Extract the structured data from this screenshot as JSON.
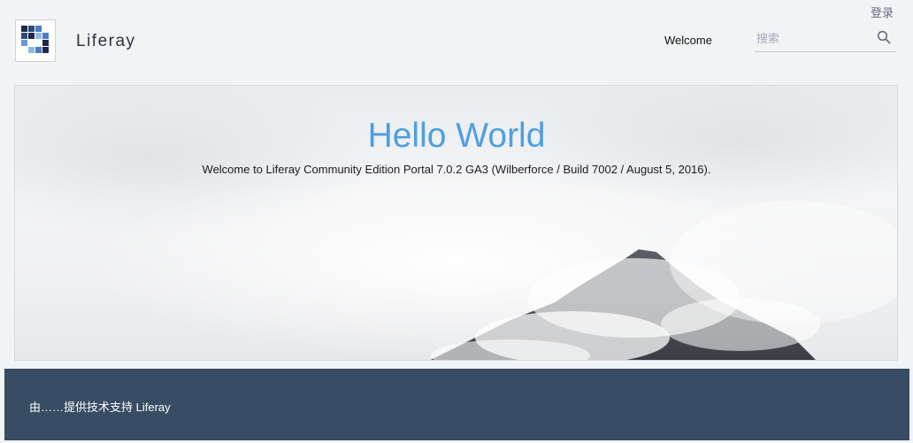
{
  "header": {
    "login_label": "登录",
    "site_name": "Liferay",
    "nav": {
      "welcome_label": "Welcome"
    },
    "search": {
      "placeholder": "搜索",
      "value": ""
    }
  },
  "hero": {
    "title": "Hello World",
    "subtitle": "Welcome to Liferay Community Edition Portal 7.0.2 GA3 (Wilberforce / Build 7002 / August 5, 2016)."
  },
  "footer": {
    "powered_by": "由……提供技术支持",
    "powered_by_link": "Liferay"
  },
  "colors": {
    "title_blue": "#4e9fe0",
    "footer_bg": "#384c63",
    "page_bg": "#f1f3f5"
  },
  "icons": {
    "search": "search-icon",
    "logo": "liferay-logo-icon"
  }
}
